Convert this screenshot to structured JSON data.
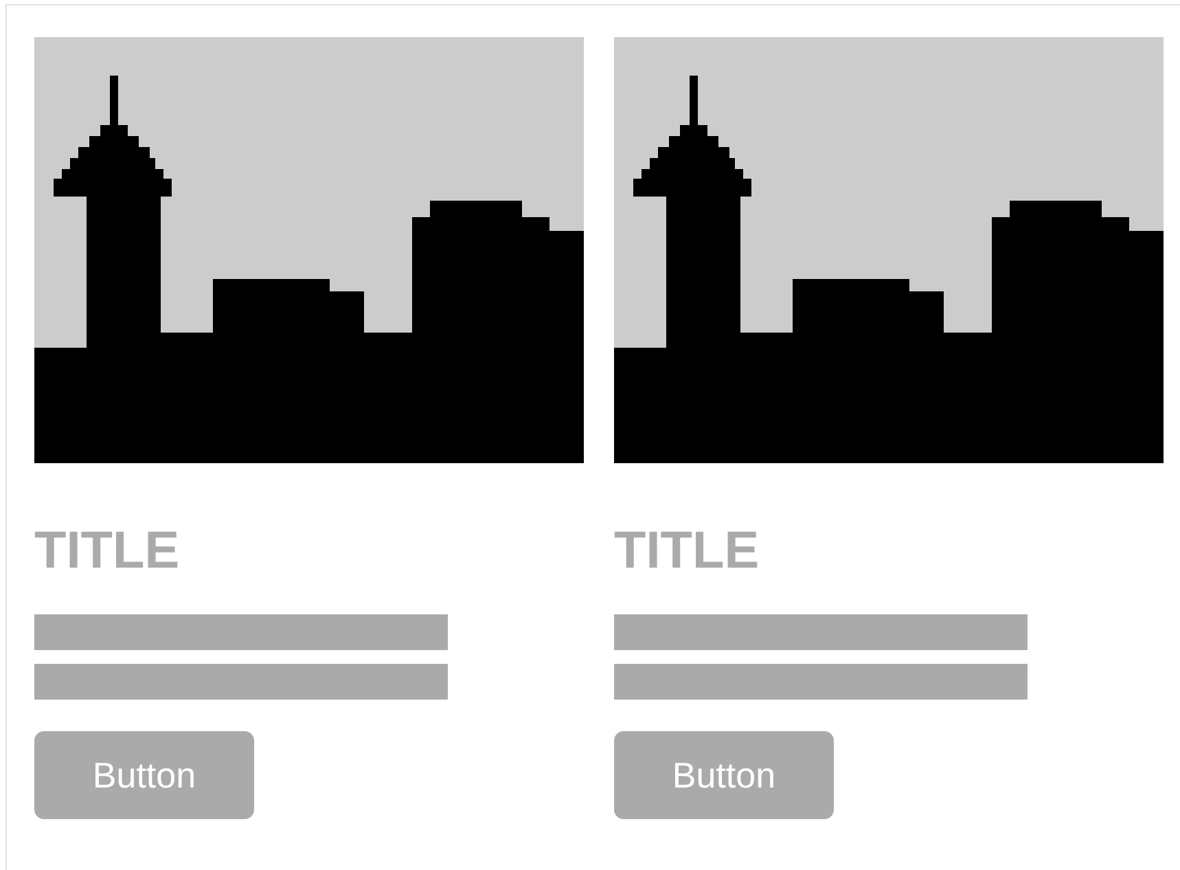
{
  "cards": [
    {
      "title": "TITLE",
      "button": "Button"
    },
    {
      "title": "TITLE",
      "button": "Button"
    }
  ]
}
